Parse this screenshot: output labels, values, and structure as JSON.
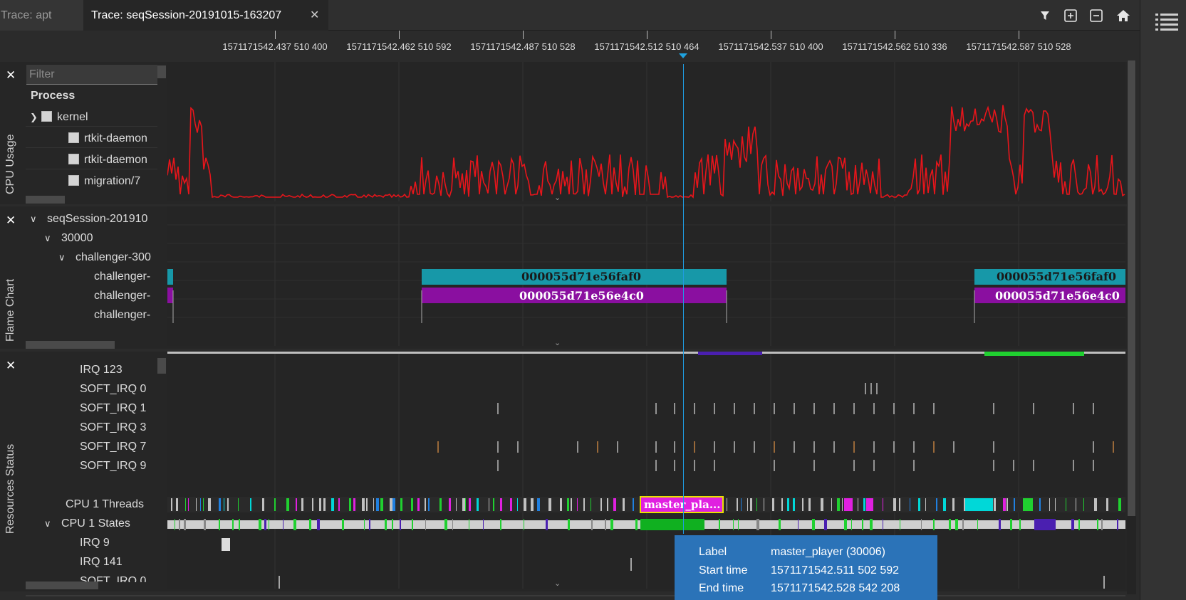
{
  "tabs": [
    {
      "label": "Trace: apt"
    },
    {
      "label": "Trace: seqSession-20191015-163207",
      "close": "✕"
    }
  ],
  "toolbar": {
    "filter_icon": "filter-icon",
    "zoom_in_icon": "zoom-in-icon",
    "zoom_out_icon": "zoom-out-icon",
    "home_icon": "home-icon"
  },
  "axis": {
    "ticks": [
      "1571171542.437 510 400",
      "1571171542.462 510 592",
      "1571171542.487 510 528",
      "1571171542.512 510 464",
      "1571171542.537 510 400",
      "1571171542.562 510 336",
      "1571171542.587 510 528"
    ]
  },
  "cpu_usage": {
    "title": "CPU Usage",
    "close": "✕",
    "filter_placeholder": "Filter",
    "column_header": "Process",
    "rows": [
      {
        "label": "kernel",
        "expanded": true
      },
      {
        "label": "rtkit-daemon"
      },
      {
        "label": "rtkit-daemon"
      },
      {
        "label": "migration/7"
      }
    ],
    "series_color": "#e8151b"
  },
  "flame_chart": {
    "title": "Flame Chart",
    "close": "✕",
    "rows": [
      {
        "label": "seqSession-201910"
      },
      {
        "label": "30000"
      },
      {
        "label": "challenger-300"
      },
      {
        "label": "challenger-"
      },
      {
        "label": "challenger-"
      },
      {
        "label": "challenger-"
      }
    ],
    "bars": [
      {
        "text": "000055d71e56faf0",
        "color": "#1798a8"
      },
      {
        "text": "000055d71e56e4c0",
        "color": "#8a0fa0"
      },
      {
        "text": "000055d71e56faf0",
        "color": "#1798a8"
      },
      {
        "text": "000055d71e56e4c0",
        "color": "#8a0fa0"
      }
    ]
  },
  "resources": {
    "title": "Resources Status",
    "close": "✕",
    "rows": [
      {
        "label": "IRQ 123"
      },
      {
        "label": "SOFT_IRQ 0"
      },
      {
        "label": "SOFT_IRQ 1"
      },
      {
        "label": "SOFT_IRQ 3"
      },
      {
        "label": "SOFT_IRQ 7"
      },
      {
        "label": "SOFT_IRQ 9"
      },
      {
        "label": "CPU 1 Threads"
      },
      {
        "label": "CPU 1 States"
      },
      {
        "label": "IRQ 9"
      },
      {
        "label": "IRQ 141"
      },
      {
        "label": "SOFT_IRQ 0"
      }
    ],
    "highlight_label": "master_pla..."
  },
  "tooltip": {
    "label_key": "Label",
    "label_val": "master_player (30006)",
    "start_key": "Start time",
    "start_val": "1571171542.511 502 592",
    "end_key": "End time",
    "end_val": "1571171542.528 542 208"
  }
}
